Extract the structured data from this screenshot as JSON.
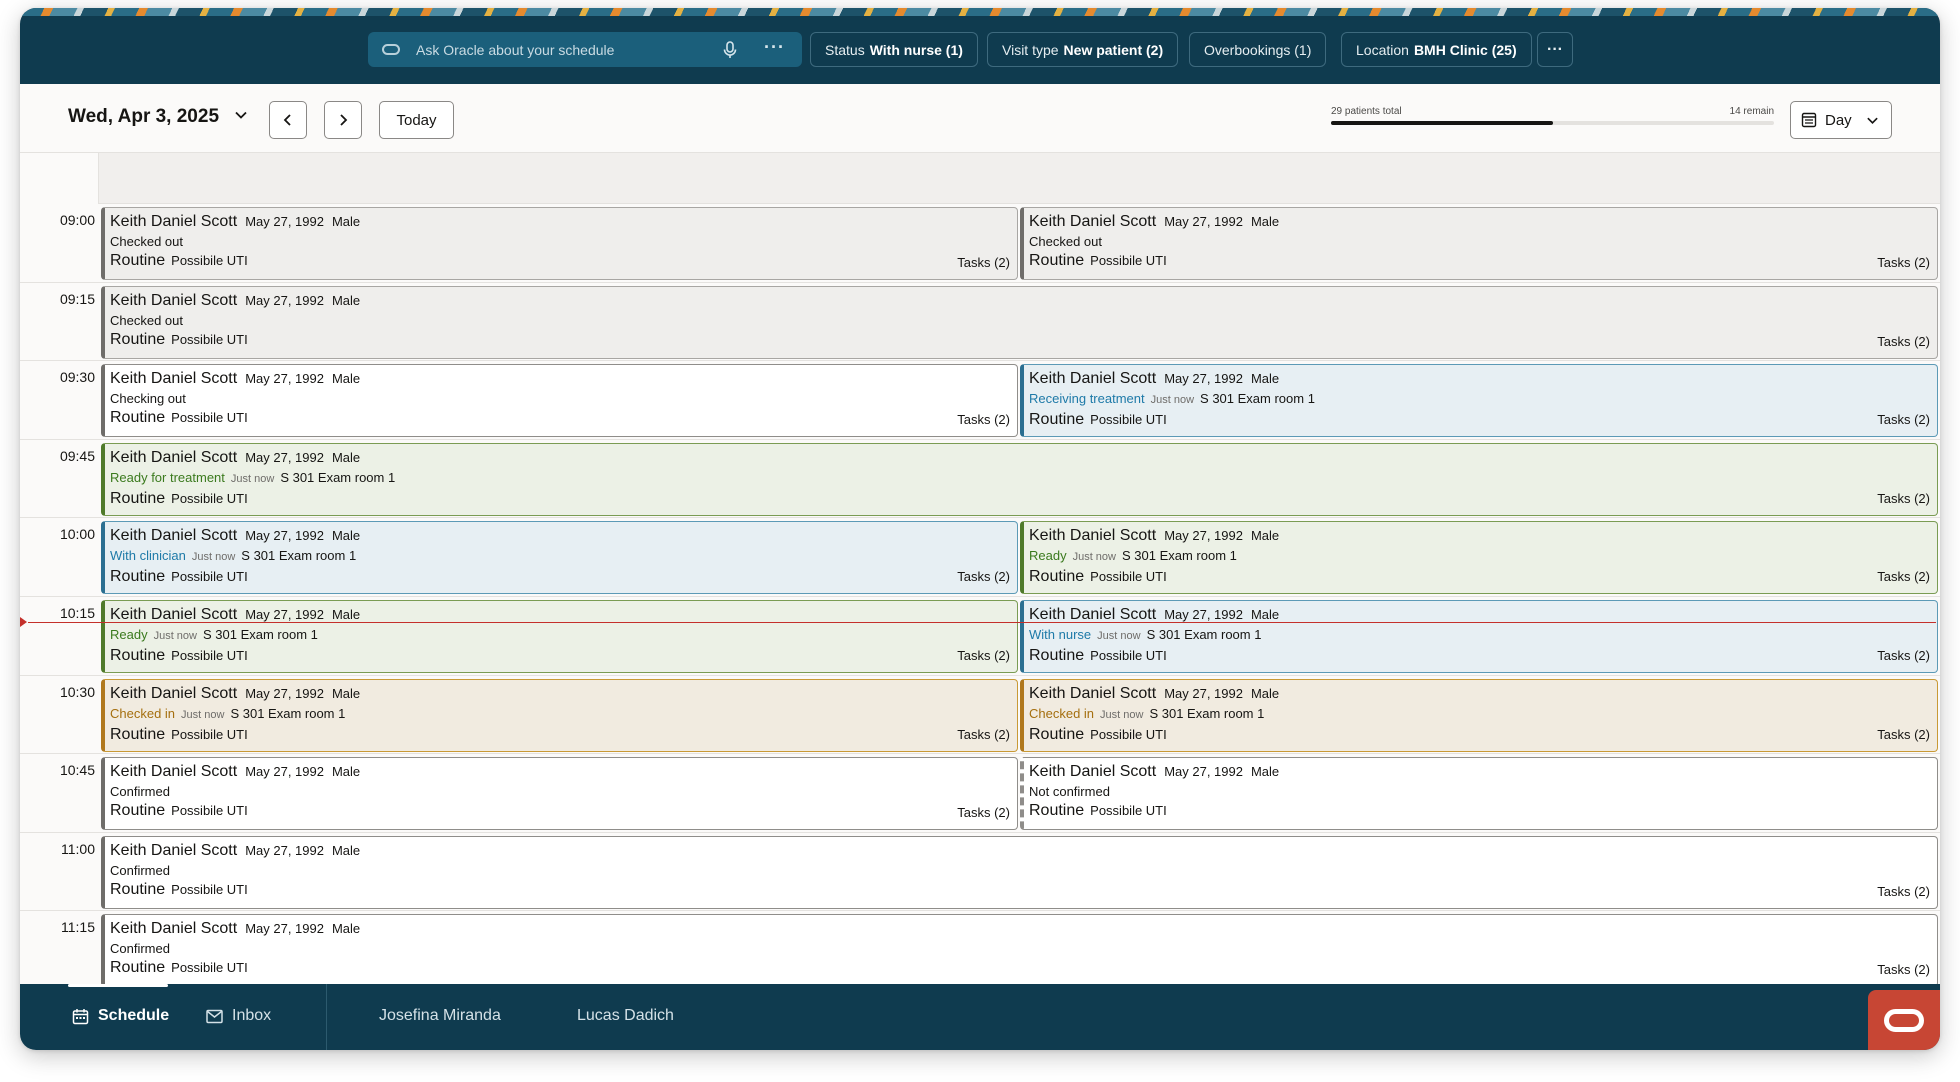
{
  "header": {
    "search_placeholder": "Ask Oracle about your schedule",
    "filters": [
      {
        "label": "Status",
        "value": "With nurse (1)"
      },
      {
        "label": "Visit type",
        "value": "New patient (2)"
      },
      {
        "label": "Overbookings (1)",
        "value": ""
      },
      {
        "label": "Location",
        "value": "BMH Clinic (25)"
      }
    ],
    "more": "···"
  },
  "toolbar": {
    "date": "Wed, Apr 3, 2025",
    "today_label": "Today",
    "patients_total": "29 patients total",
    "remain": "14 remain",
    "progress_fraction": 0.5,
    "view_label": "Day"
  },
  "times": [
    "09:00",
    "09:15",
    "09:30",
    "09:45",
    "10:00",
    "10:15",
    "10:30",
    "10:45",
    "11:00",
    "11:15"
  ],
  "appointments": [
    {
      "name": "Keith Daniel Scott",
      "dob": "May 27, 1992",
      "gender": "Male",
      "status": "Checked out",
      "ago": "",
      "room": "",
      "priority": "Routine",
      "reason": "Possibile UTI",
      "tasks": "Tasks (2)"
    },
    {
      "name": "Keith Daniel Scott",
      "dob": "May 27, 1992",
      "gender": "Male",
      "status": "Checked out",
      "ago": "",
      "room": "",
      "priority": "Routine",
      "reason": "Possibile UTI",
      "tasks": "Tasks (2)"
    },
    {
      "name": "Keith Daniel Scott",
      "dob": "May 27, 1992",
      "gender": "Male",
      "status": "Checked out",
      "ago": "",
      "room": "",
      "priority": "Routine",
      "reason": "Possibile UTI",
      "tasks": "Tasks (2)"
    },
    {
      "name": "Keith Daniel Scott",
      "dob": "May 27, 1992",
      "gender": "Male",
      "status": "Checking out",
      "ago": "",
      "room": "",
      "priority": "Routine",
      "reason": "Possibile UTI",
      "tasks": "Tasks (2)"
    },
    {
      "name": "Keith Daniel Scott",
      "dob": "May 27, 1992",
      "gender": "Male",
      "status": "Receiving treatment",
      "ago": "Just now",
      "room": "S 301 Exam room 1",
      "priority": "Routine",
      "reason": "Possibile UTI",
      "tasks": "Tasks (2)"
    },
    {
      "name": "Keith Daniel Scott",
      "dob": "May 27, 1992",
      "gender": "Male",
      "status": "Ready for treatment",
      "ago": "Just now",
      "room": "S 301 Exam room 1",
      "priority": "Routine",
      "reason": "Possibile UTI",
      "tasks": "Tasks (2)"
    },
    {
      "name": "Keith Daniel Scott",
      "dob": "May 27, 1992",
      "gender": "Male",
      "status": "With clinician",
      "ago": "Just now",
      "room": "S 301 Exam room 1",
      "priority": "Routine",
      "reason": "Possibile UTI",
      "tasks": "Tasks (2)"
    },
    {
      "name": "Keith Daniel Scott",
      "dob": "May 27, 1992",
      "gender": "Male",
      "status": "Ready",
      "ago": "Just now",
      "room": "S 301 Exam room 1",
      "priority": "Routine",
      "reason": "Possibile UTI",
      "tasks": "Tasks (2)"
    },
    {
      "name": "Keith Daniel Scott",
      "dob": "May 27, 1992",
      "gender": "Male",
      "status": "Ready",
      "ago": "Just now",
      "room": "S 301 Exam room 1",
      "priority": "Routine",
      "reason": "Possibile UTI",
      "tasks": "Tasks (2)"
    },
    {
      "name": "Keith Daniel Scott",
      "dob": "May 27, 1992",
      "gender": "Male",
      "status": "With nurse",
      "ago": "Just now",
      "room": "S 301 Exam room 1",
      "priority": "Routine",
      "reason": "Possibile UTI",
      "tasks": "Tasks (2)"
    },
    {
      "name": "Keith Daniel Scott",
      "dob": "May 27, 1992",
      "gender": "Male",
      "status": "Checked in",
      "ago": "Just now",
      "room": "S 301 Exam room 1",
      "priority": "Routine",
      "reason": "Possibile UTI",
      "tasks": "Tasks (2)"
    },
    {
      "name": "Keith Daniel Scott",
      "dob": "May 27, 1992",
      "gender": "Male",
      "status": "Checked in",
      "ago": "Just now",
      "room": "S 301 Exam room 1",
      "priority": "Routine",
      "reason": "Possibile UTI",
      "tasks": "Tasks (2)"
    },
    {
      "name": "Keith Daniel Scott",
      "dob": "May 27, 1992",
      "gender": "Male",
      "status": "Confirmed",
      "ago": "",
      "room": "",
      "priority": "Routine",
      "reason": "Possibile UTI",
      "tasks": "Tasks (2)"
    },
    {
      "name": "Keith Daniel Scott",
      "dob": "May 27, 1992",
      "gender": "Male",
      "status": "Not confirmed",
      "ago": "",
      "room": "",
      "priority": "Routine",
      "reason": "Possibile UTI",
      "tasks": ""
    },
    {
      "name": "Keith Daniel Scott",
      "dob": "May 27, 1992",
      "gender": "Male",
      "status": "Confirmed",
      "ago": "",
      "room": "",
      "priority": "Routine",
      "reason": "Possibile UTI",
      "tasks": "Tasks (2)"
    },
    {
      "name": "Keith Daniel Scott",
      "dob": "May 27, 1992",
      "gender": "Male",
      "status": "Confirmed",
      "ago": "",
      "room": "",
      "priority": "Routine",
      "reason": "Possibile UTI",
      "tasks": "Tasks (2)"
    }
  ],
  "footer": {
    "schedule": "Schedule",
    "inbox": "Inbox",
    "users": [
      "Josefina Miranda",
      "Lucas Dadich"
    ]
  },
  "colors": {
    "header_bg": "#0f3b4f",
    "accent_red": "#c74634",
    "now_line": "#c4302b"
  }
}
